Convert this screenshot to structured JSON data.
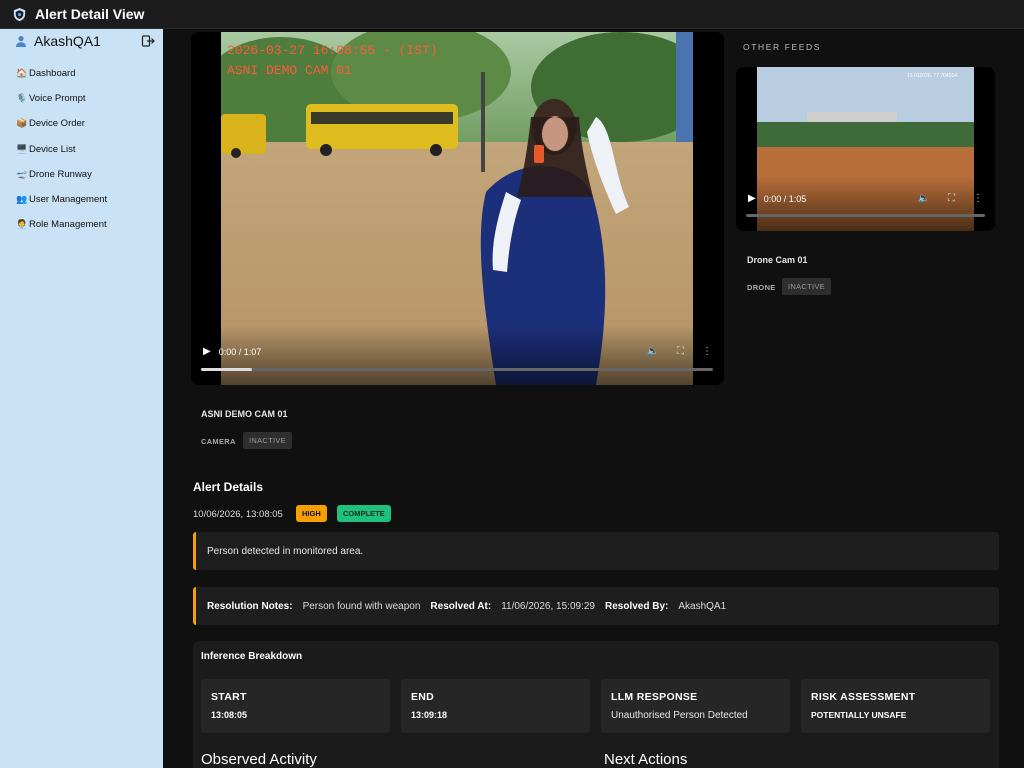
{
  "header": {
    "title": "Alert Detail View",
    "icon": "shield-icon"
  },
  "sidebar": {
    "username": "AkashQA1",
    "items": [
      {
        "label": "Dashboard",
        "icon": "🏠"
      },
      {
        "label": "Voice Prompt",
        "icon": "🎙️"
      },
      {
        "label": "Device Order",
        "icon": "📦"
      },
      {
        "label": "Device List",
        "icon": "🖥️"
      },
      {
        "label": "Drone Runway",
        "icon": "🛫"
      },
      {
        "label": "User Management",
        "icon": "👥"
      },
      {
        "label": "Role Management",
        "icon": "🧑‍💼"
      }
    ]
  },
  "main_video": {
    "overlay_timestamp": "2026-03-27 16:08:55 - (IST)",
    "overlay_cam": "ASNI DEMO CAM 01",
    "time": "0:00 / 1:07",
    "progress": 0.1,
    "camera_name": "ASNI DEMO CAM 01",
    "type": "CAMERA",
    "status": "INACTIVE"
  },
  "other_feeds": {
    "title": "OTHER FEEDS",
    "feeds": [
      {
        "overlay": "13.012026, 77.704014",
        "time": "0:00 / 1:05",
        "name": "Drone Cam 01",
        "type": "DRONE",
        "status": "INACTIVE"
      }
    ]
  },
  "alert": {
    "title": "Alert Details",
    "datetime": "10/06/2026, 13:08:05",
    "severity": "HIGH",
    "state": "COMPLETE",
    "message": "Person detected in monitored area.",
    "resolution": {
      "notes_label": "Resolution Notes:",
      "notes": "Person found with weapon",
      "at_label": "Resolved At:",
      "at": "11/06/2026, 15:09:29",
      "by_label": "Resolved By:",
      "by": "AkashQA1"
    }
  },
  "inference": {
    "title": "Inference Breakdown",
    "cards": [
      {
        "label": "START",
        "value": "13:08:05"
      },
      {
        "label": "END",
        "value": "13:09:18"
      },
      {
        "label": "LLM RESPONSE",
        "value": "Unauthorised Person Detected"
      },
      {
        "label": "RISK ASSESSMENT",
        "value": "POTENTIALLY UNSAFE"
      }
    ],
    "observed_activity": "Observed Activity",
    "next_actions": "Next Actions"
  },
  "colors": {
    "sidebar_bg": "#c9e2f6",
    "high": "#f5a000",
    "complete": "#1ec27e",
    "accent_bar": "#f5a000"
  }
}
